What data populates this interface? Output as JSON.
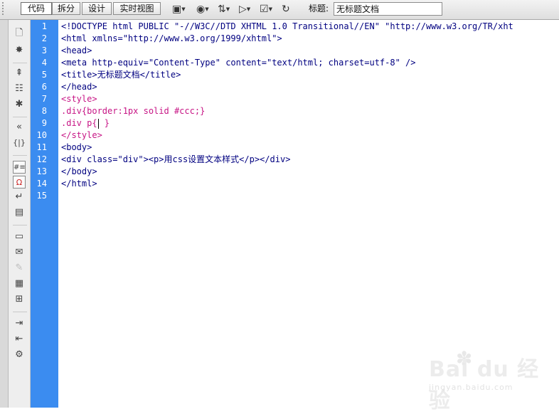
{
  "toolbar": {
    "view_buttons": [
      "代码",
      "拆分",
      "设计",
      "实时视图"
    ],
    "title_label": "标题:",
    "title_value": "无标题文档",
    "icons": [
      "multiscreen-icon",
      "globe-preview-icon",
      "file-transfer-icon",
      "validate-icon",
      "check-browser-icon",
      "refresh-icon"
    ]
  },
  "left_toolbar": {
    "icons": [
      "open-documents-icon",
      "show-code-navigator-icon",
      "collapse-full-tag-icon",
      "collapse-selection-icon",
      "expand-all-icon",
      "select-parent-tag-icon",
      "balance-braces-icon",
      "line-numbers-icon",
      "highlight-invalid-code-icon",
      "word-wrap-icon",
      "syntax-error-icon",
      "apply-comment-icon",
      "remove-comment-icon",
      "wrap-tag-icon",
      "recent-snippets-icon",
      "move-css-icon",
      "indent-code-icon",
      "outdent-code-icon",
      "format-source-icon"
    ]
  },
  "editor": {
    "line_numbers": [
      "1",
      "2",
      "3",
      "4",
      "5",
      "6",
      "7",
      "8",
      "9",
      "10",
      "11",
      "12",
      "13",
      "14",
      "15"
    ],
    "lines": [
      "<!DOCTYPE html PUBLIC \"-//W3C//DTD XHTML 1.0 Transitional//EN\" \"http://www.w3.org/TR/xht",
      "<html xmlns=\"http://www.w3.org/1999/xhtml\">",
      "<head>",
      "<meta http-equiv=\"Content-Type\" content=\"text/html; charset=utf-8\" />",
      "<title>无标题文档</title>",
      "</head>",
      "<style>",
      ".div{border:1px solid #ccc;}",
      ".div p{ }",
      "</style>",
      "<body>",
      "<div class=\"div\"><p>用css设置文本样式</p></div>",
      "</body>",
      "</html>",
      ""
    ]
  },
  "watermark": {
    "logo": "Bai du 经验",
    "url": "jingyan.baidu.com"
  },
  "colors": {
    "gutter": "#3b8cf0",
    "tag_text": "#000080",
    "css_text": "#c71585"
  }
}
